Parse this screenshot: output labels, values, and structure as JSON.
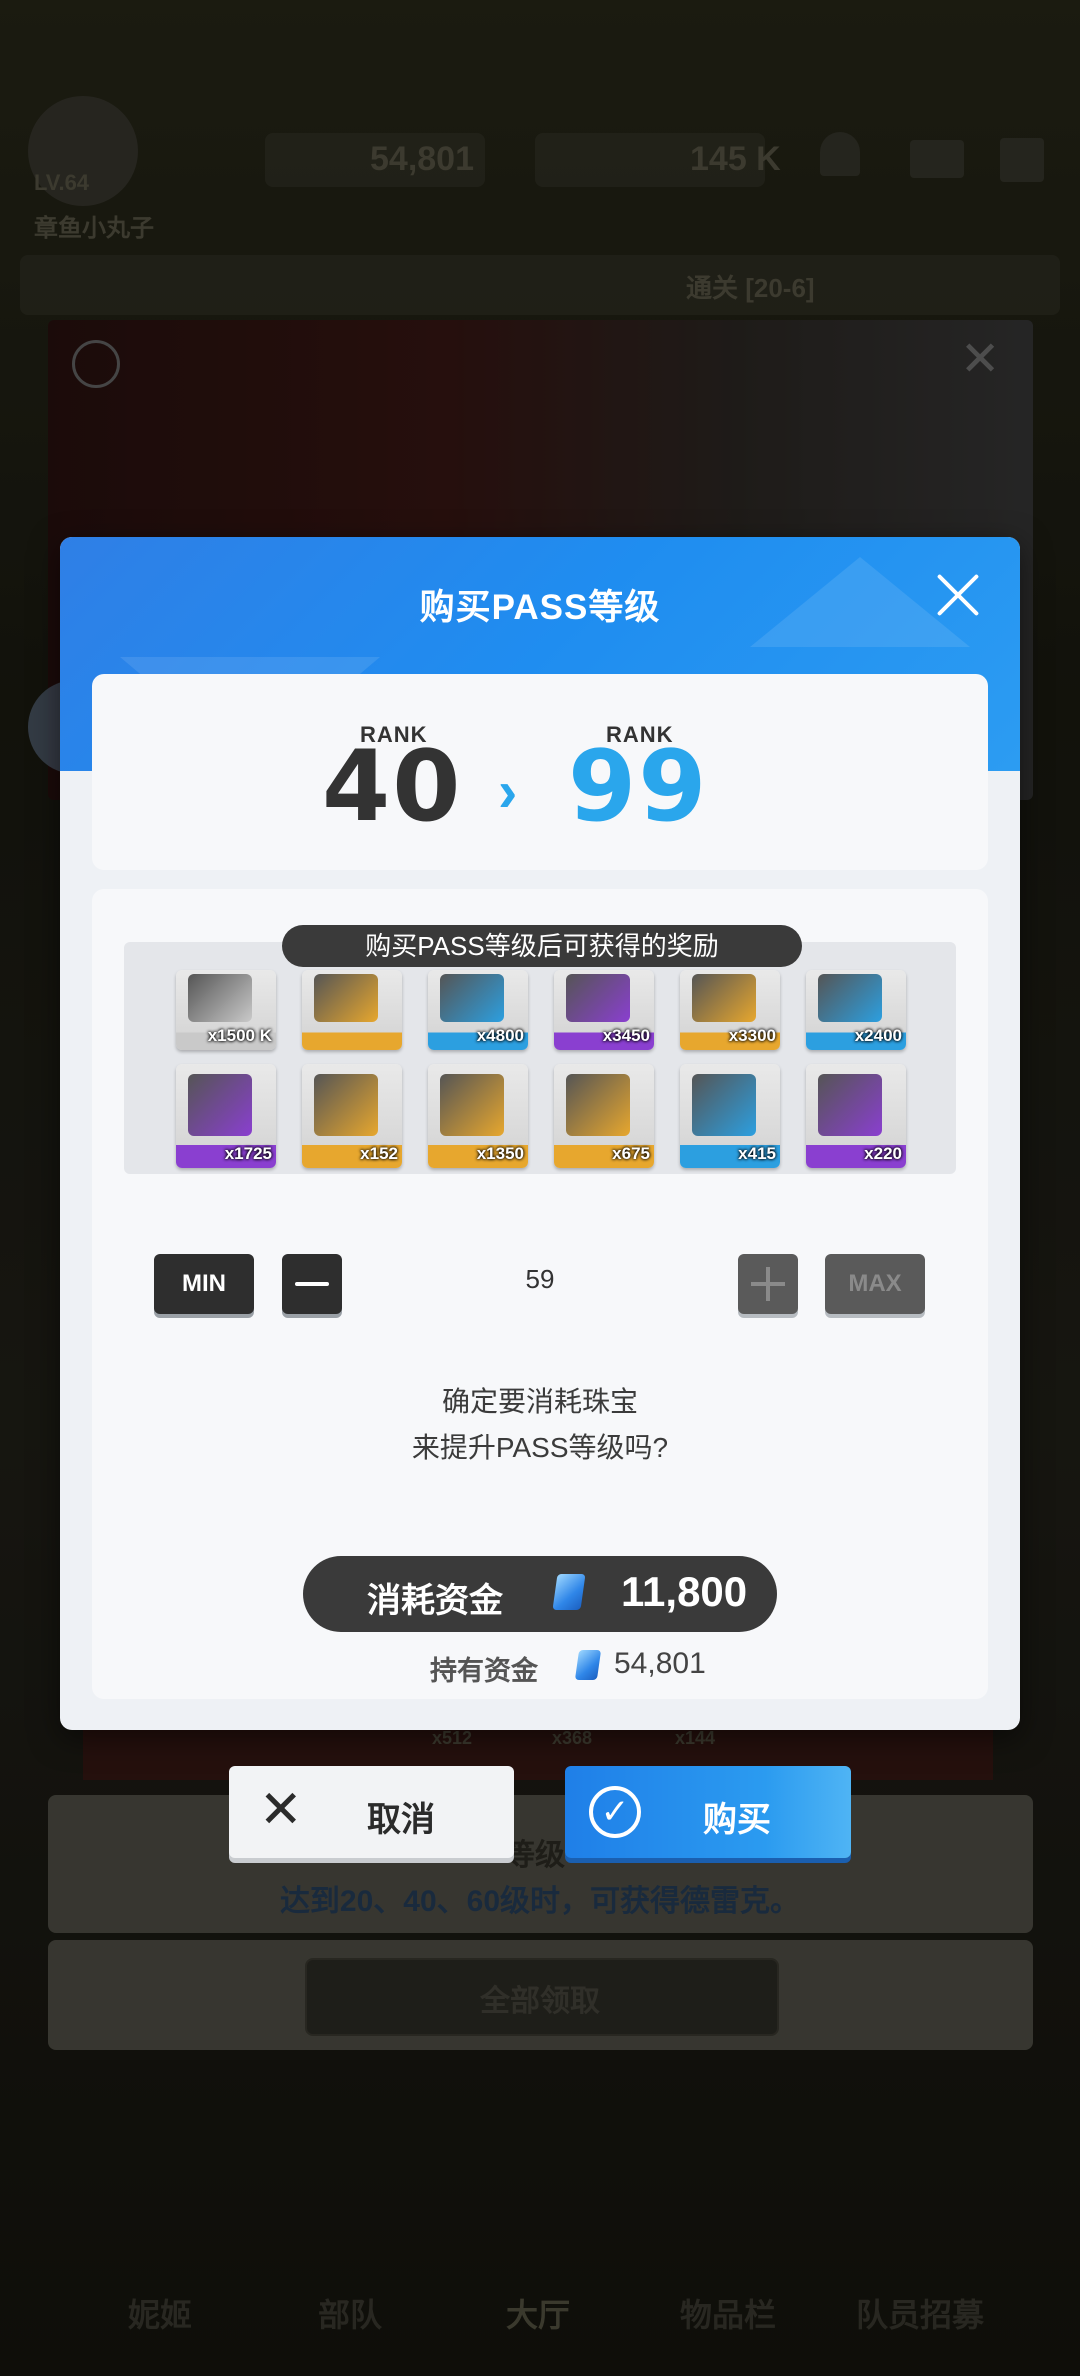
{
  "background": {
    "player_level": "LV.64",
    "player_name": "章鱼小丸子",
    "gems": "54,801",
    "credits": "145 K",
    "stage": "通关 [20-6]",
    "event_line1": "等级",
    "event_line2": "达到20、40、60级时，可获得德雷克。",
    "claim_all": "全部领取",
    "strip_qtys": [
      "x512",
      "x368",
      "x144"
    ],
    "nav_items": [
      "妮姬",
      "部队",
      "大厅",
      "物品栏",
      "队员招募"
    ]
  },
  "dialog": {
    "title": "购买PASS等级",
    "rank_label": "RANK",
    "rank_from": "40",
    "rank_to": "99",
    "rewards_title": "购买PASS等级后可获得的奖励",
    "rewards": [
      {
        "qty": "x1500 K",
        "color": "#c9c9c9",
        "icon": "credit-chip-icon"
      },
      {
        "qty": "",
        "color": "#e7a72e",
        "icon": "character-portrait-icon"
      },
      {
        "qty": "x4800",
        "color": "#2c9fe0",
        "icon": "blue-core-icon"
      },
      {
        "qty": "x3450",
        "color": "#8a3fd0",
        "icon": "purple-core-icon"
      },
      {
        "qty": "x3300",
        "color": "#e7a72e",
        "icon": "orange-box-icon"
      },
      {
        "qty": "x2400",
        "color": "#2c9fe0",
        "icon": "blue-chip-icon"
      },
      {
        "qty": "x1725",
        "color": "#8a3fd0",
        "icon": "purple-chip-icon"
      },
      {
        "qty": "x152",
        "color": "#e7a72e",
        "icon": "circuit-board-icon"
      },
      {
        "qty": "x1350",
        "color": "#e7a72e",
        "icon": "gold-core-icon"
      },
      {
        "qty": "x675",
        "color": "#e7a72e",
        "icon": "gold-chip-icon"
      },
      {
        "qty": "x415",
        "color": "#2c9fe0",
        "icon": "blue-toolbox-icon"
      },
      {
        "qty": "x220",
        "color": "#8a3fd0",
        "icon": "purple-toolbox-icon"
      }
    ],
    "min_label": "MIN",
    "max_label": "MAX",
    "quantity": "59",
    "confirm_line1": "确定要消耗珠宝",
    "confirm_line2": "来提升PASS等级吗?",
    "cost_label": "消耗资金",
    "cost_value": "11,800",
    "owned_label": "持有资金",
    "owned_value": "54,801",
    "cancel_label": "取消",
    "buy_label": "购买"
  },
  "colors": {
    "accent_blue": "#1f8df0",
    "rank_blue": "#2aa6ec",
    "dark": "#333333"
  }
}
